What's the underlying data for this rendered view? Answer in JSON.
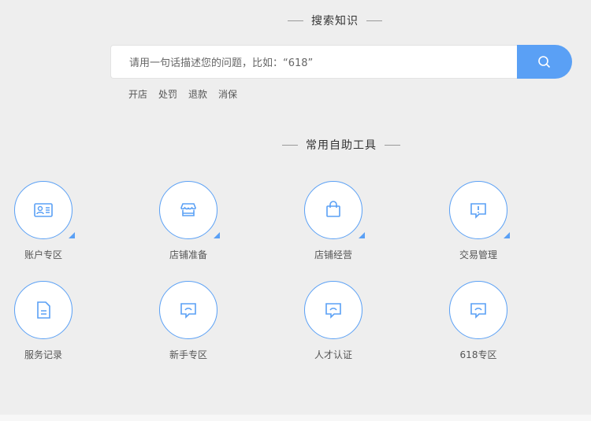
{
  "search_section": {
    "title": "搜索知识",
    "placeholder": "请用一句话描述您的问题，比如：“618”",
    "hot_tags": [
      "开店",
      "处罚",
      "退款",
      "消保"
    ]
  },
  "tools_section": {
    "title": "常用自助工具",
    "items": [
      {
        "label": "账户专区",
        "icon": "id-card-icon",
        "expandable": true
      },
      {
        "label": "店铺准备",
        "icon": "store-icon",
        "expandable": true
      },
      {
        "label": "店铺经营",
        "icon": "shopping-bag-icon",
        "expandable": true
      },
      {
        "label": "交易管理",
        "icon": "alert-chat-icon",
        "expandable": true
      },
      {
        "label": "服务记录",
        "icon": "document-icon",
        "expandable": false
      },
      {
        "label": "新手专区",
        "icon": "chat-icon",
        "expandable": false
      },
      {
        "label": "人才认证",
        "icon": "chat-icon",
        "expandable": false
      },
      {
        "label": "618专区",
        "icon": "chat-icon",
        "expandable": false
      }
    ]
  },
  "colors": {
    "accent": "#5aa0f5",
    "background": "#eeeeee"
  }
}
